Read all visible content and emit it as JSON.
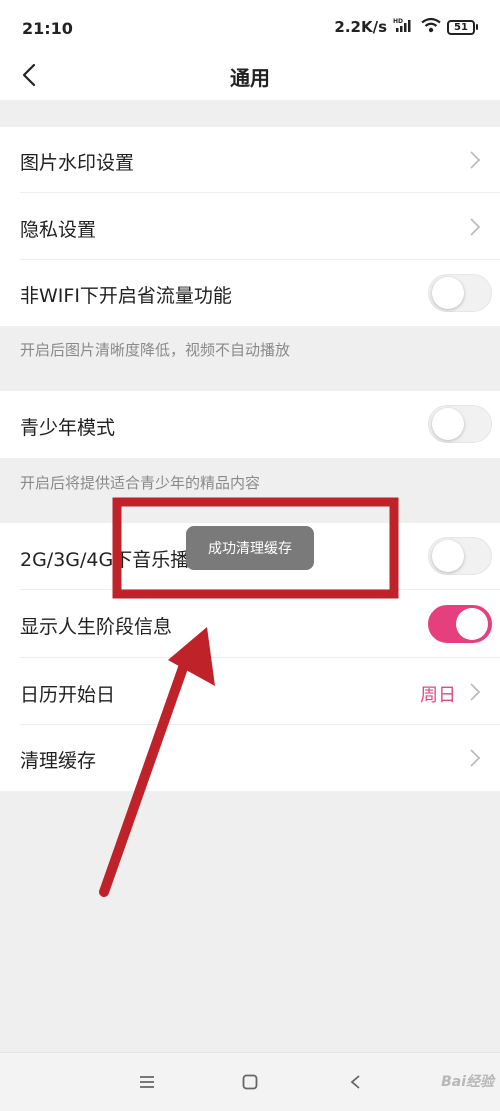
{
  "status_bar": {
    "time": "21:10",
    "speed": "2.2K/s",
    "battery": "51",
    "icons": [
      "hd-signal-icon",
      "wifi-icon",
      "battery-icon"
    ]
  },
  "header": {
    "title": "通用",
    "back_icon": "chevron-left-icon"
  },
  "settings": {
    "watermark": {
      "label": "图片水印设置"
    },
    "privacy": {
      "label": "隐私设置"
    },
    "non_wifi_saver": {
      "label": "非WIFI下开启省流量功能",
      "enabled": false,
      "hint": "开启后图片清晰度降低，视频不自动播放"
    },
    "youth_mode": {
      "label": "青少年模式",
      "enabled": false,
      "hint": "开启后将提供适合青少年的精品内容"
    },
    "mobile_music": {
      "label": "2G/3G/4G下音乐播放",
      "enabled": false
    },
    "life_stage": {
      "label": "显示人生阶段信息",
      "enabled": true
    },
    "calendar_start": {
      "label": "日历开始日",
      "value": "周日"
    },
    "clear_cache": {
      "label": "清理缓存"
    }
  },
  "toast": {
    "text": "成功清理缓存"
  },
  "nav_bar": {
    "icons": [
      "menu-icon",
      "home-square-icon",
      "back-triangle-icon"
    ]
  },
  "watermark_text": "Bai经验",
  "colors": {
    "accent": "#e63f7e",
    "annotation": "#c0222a",
    "value_text": "#e14a83"
  }
}
